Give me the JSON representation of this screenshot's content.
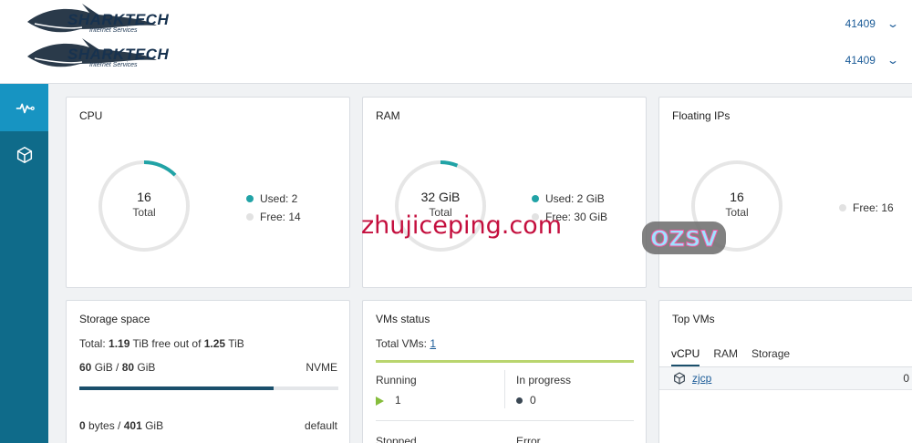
{
  "header": {
    "logo_text": "SHARKTECH",
    "logo_sub": "Internet Services",
    "accounts": [
      {
        "id": "41409"
      },
      {
        "id": "41409"
      }
    ]
  },
  "sidebar": {
    "items": [
      {
        "icon": "activity-icon",
        "active": true
      },
      {
        "icon": "cube-icon",
        "active": false
      }
    ]
  },
  "cpu": {
    "title": "CPU",
    "total": "16",
    "total_label": "Total",
    "used_label": "Used: 2",
    "free_label": "Free: 14",
    "used_fraction": 0.125
  },
  "ram": {
    "title": "RAM",
    "total": "32 GiB",
    "total_label": "Total",
    "used_label": "Used: 2 GiB",
    "free_label": "Free: 30 GiB",
    "used_fraction": 0.0625
  },
  "floating_ips": {
    "title": "Floating IPs",
    "total": "16",
    "total_label": "Total",
    "free_label": "Free: 16",
    "used_fraction": 0
  },
  "storage": {
    "title": "Storage space",
    "total_prefix": "Total: ",
    "total_free": "1.19",
    "total_mid": " TiB free out of ",
    "total_all": "1.25",
    "total_suffix": " TiB",
    "nvme_used": "60",
    "nvme_used_unit": " GiB / ",
    "nvme_total": "80",
    "nvme_total_unit": " GiB",
    "nvme_label": "NVME",
    "nvme_fraction": 0.75,
    "default_used": "0",
    "default_used_unit": " bytes / ",
    "default_total": "401",
    "default_total_unit": " GiB",
    "default_label": "default"
  },
  "vms_status": {
    "title": "VMs status",
    "total_label": "Total VMs: ",
    "total_value": "1",
    "running_label": "Running",
    "running_value": "1",
    "in_progress_label": "In progress",
    "in_progress_value": "0",
    "stopped_label": "Stopped",
    "error_label": "Error"
  },
  "top_vms": {
    "title": "Top VMs",
    "tabs": [
      "vCPU",
      "RAM",
      "Storage"
    ],
    "active_tab": 0,
    "rows": [
      {
        "name": "zjcp",
        "value": "0"
      }
    ]
  },
  "watermark": {
    "text": "zhujiceping.com",
    "badge": "OZSV"
  },
  "colors": {
    "accent_teal": "#21a3a6",
    "sidebar": "#0f6b8a",
    "sidebar_active": "#1794c2",
    "link": "#1c5c98"
  }
}
